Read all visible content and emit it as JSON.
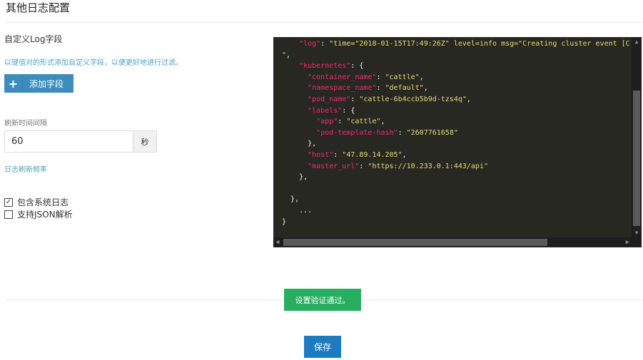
{
  "section": {
    "title": "其他日志配置"
  },
  "custom_fields": {
    "label": "自定义Log字段",
    "help": "以键值对的形式添加自定义字段，以便更好地进行过滤。",
    "add_button": {
      "icon": "plus-icon",
      "label": "添加字段"
    }
  },
  "refresh": {
    "label": "刷新时间间隔",
    "value": "60",
    "unit": "秒",
    "help": "日志刷新频率"
  },
  "options": [
    {
      "label": "包含系统日志",
      "checked": true
    },
    {
      "label": "支持JSON解析",
      "checked": false
    }
  ],
  "code_preview": {
    "lines": [
      [
        [
          "    ",
          "p"
        ],
        [
          "\"log\"",
          "k"
        ],
        [
          ": ",
          "p"
        ],
        [
          "\"time=\"2018-01-15T17:49:26Z\" level=info msg=\"Creating cluster event [C",
          "s"
        ]
      ],
      [
        [
          "\"",
          "s"
        ],
        [
          ",",
          "p"
        ]
      ],
      [
        [
          "    ",
          "p"
        ],
        [
          "\"kubernetes\"",
          "k"
        ],
        [
          ": {",
          "p"
        ]
      ],
      [
        [
          "      ",
          "p"
        ],
        [
          "\"container_name\"",
          "k"
        ],
        [
          ": ",
          "p"
        ],
        [
          "\"cattle\"",
          "s"
        ],
        [
          ",",
          "p"
        ]
      ],
      [
        [
          "      ",
          "p"
        ],
        [
          "\"namespace_name\"",
          "k"
        ],
        [
          ": ",
          "p"
        ],
        [
          "\"default\"",
          "s"
        ],
        [
          ",",
          "p"
        ]
      ],
      [
        [
          "      ",
          "p"
        ],
        [
          "\"pod_name\"",
          "k"
        ],
        [
          ": ",
          "p"
        ],
        [
          "\"cattle-6b4ccb5b9d-tzs4q\"",
          "s"
        ],
        [
          ",",
          "p"
        ]
      ],
      [
        [
          "      ",
          "p"
        ],
        [
          "\"labels\"",
          "k"
        ],
        [
          ": {",
          "p"
        ]
      ],
      [
        [
          "        ",
          "p"
        ],
        [
          "\"app\"",
          "k"
        ],
        [
          ": ",
          "p"
        ],
        [
          "\"cattle\"",
          "s"
        ],
        [
          ",",
          "p"
        ]
      ],
      [
        [
          "        ",
          "p"
        ],
        [
          "\"pod-template-hash\"",
          "k"
        ],
        [
          ": ",
          "p"
        ],
        [
          "\"2607761658\"",
          "s"
        ]
      ],
      [
        [
          "      },",
          "p"
        ]
      ],
      [
        [
          "      ",
          "p"
        ],
        [
          "\"host\"",
          "k"
        ],
        [
          ": ",
          "p"
        ],
        [
          "\"47.89.14.205\"",
          "s"
        ],
        [
          ",",
          "p"
        ]
      ],
      [
        [
          "      ",
          "p"
        ],
        [
          "\"master_url\"",
          "k"
        ],
        [
          ": ",
          "p"
        ],
        [
          "\"https://10.233.0.1:443/api\"",
          "s"
        ]
      ],
      [
        [
          "    },",
          "p"
        ]
      ],
      [
        [
          "",
          "p"
        ]
      ],
      [
        [
          "  },",
          "p"
        ]
      ],
      [
        [
          "    ...",
          "p"
        ]
      ],
      [
        [
          "}",
          "p"
        ]
      ]
    ]
  },
  "status": {
    "message": "设置验证通过。"
  },
  "save_button": {
    "label": "保存"
  },
  "colors": {
    "primary": "#3c8dbc",
    "success": "#27ae60",
    "editor_bg": "#272822",
    "json_key": "#f92672",
    "json_string": "#e6db74"
  }
}
